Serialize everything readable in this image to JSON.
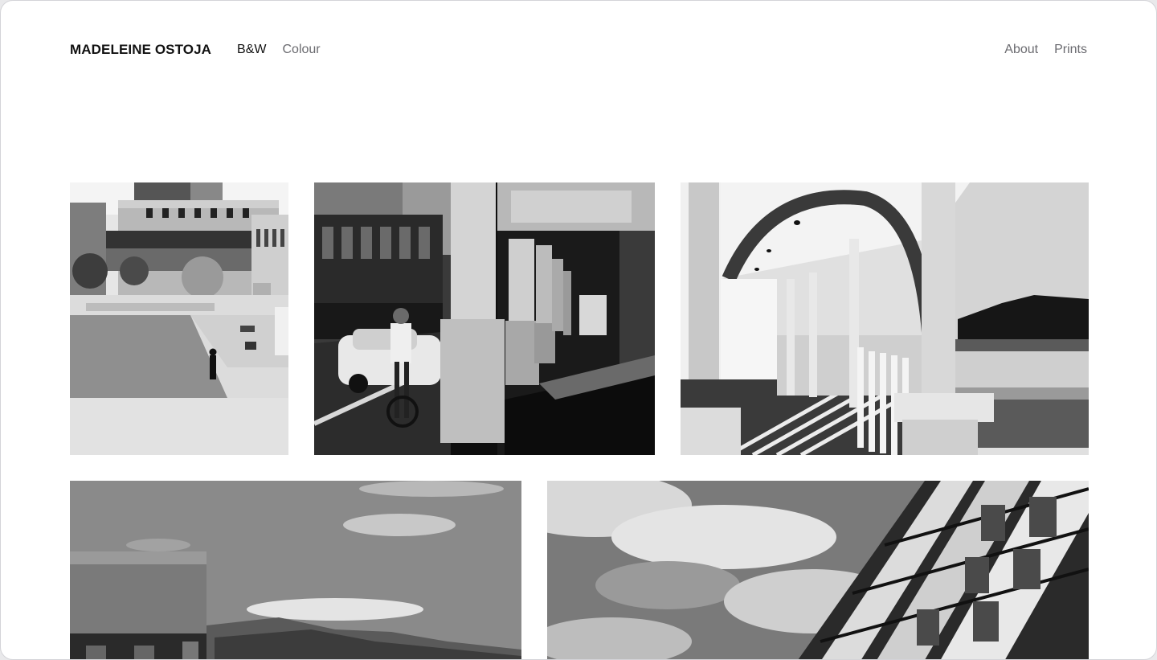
{
  "header": {
    "brand": "MADELEINE OSTOJA",
    "nav_left": [
      {
        "label": "B&W",
        "active": true
      },
      {
        "label": "Colour",
        "active": false
      }
    ],
    "nav_right": [
      {
        "label": "About"
      },
      {
        "label": "Prints"
      }
    ]
  },
  "gallery": {
    "mode": "B&W",
    "photos": [
      {
        "subject": "city square with a lone figure in a hat"
      },
      {
        "subject": "cyclist passing under a colonnade"
      },
      {
        "subject": "beachside veranda with arches"
      },
      {
        "subject": "concrete building and hills under clouds"
      },
      {
        "subject": "glass building against a cloudy sky"
      }
    ]
  },
  "colors": {
    "text_primary": "#111111",
    "text_secondary": "#6b6b70",
    "background": "#ffffff"
  }
}
